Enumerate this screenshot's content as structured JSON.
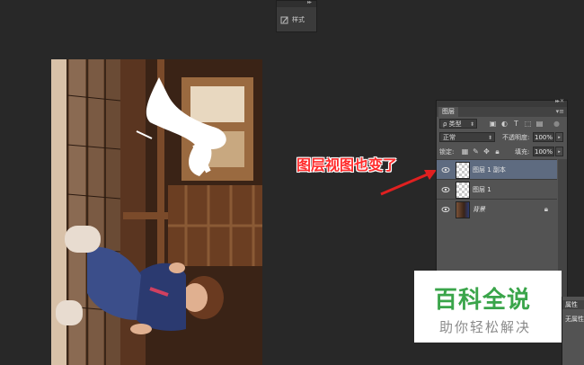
{
  "styles_panel": {
    "label": "样式"
  },
  "annotation": {
    "text": "图层视图也变了",
    "color": "#ff2b2b"
  },
  "layers_panel": {
    "tab": "图层",
    "filter": {
      "selected": "类型"
    },
    "blend_mode": {
      "selected": "正常"
    },
    "opacity": {
      "label": "不透明度:",
      "value": "100%"
    },
    "lock": {
      "label": "锁定:"
    },
    "fill": {
      "label": "填充:",
      "value": "100%"
    },
    "layers": [
      {
        "name": "图层 1 副本",
        "visible": true,
        "active": true
      },
      {
        "name": "图层 1",
        "visible": true,
        "active": false
      },
      {
        "name": "背景",
        "visible": true,
        "active": false,
        "locked": true
      }
    ],
    "active_color": "#5e6b80"
  },
  "properties_panel": {
    "tab": "属性",
    "text": "无属性"
  },
  "watermark": {
    "title": "百科全说",
    "subtitle": "助你轻松解决",
    "color": "#3aa54a"
  }
}
